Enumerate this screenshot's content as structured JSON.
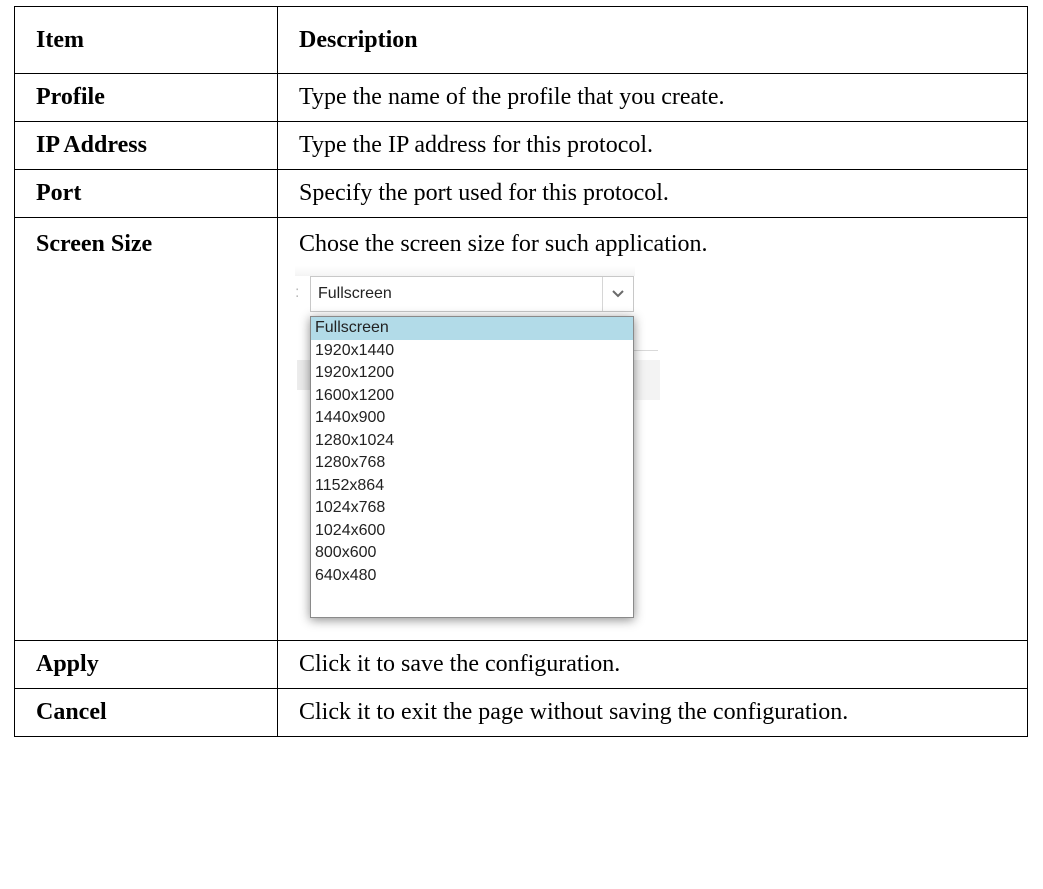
{
  "table": {
    "header": {
      "item": "Item",
      "description": "Description"
    },
    "rows": [
      {
        "item": "Profile",
        "description": "Type the name of the profile that you create."
      },
      {
        "item": "IP Address",
        "description": "Type the IP address for this protocol."
      },
      {
        "item": "Port",
        "description": "Specify the port used for this protocol."
      },
      {
        "item": "Screen Size",
        "description": "Chose the screen size for such application."
      },
      {
        "item": "Apply",
        "description": "Click it to save the configuration."
      },
      {
        "item": "Cancel",
        "description": "Click it to exit the page without saving the configuration."
      }
    ]
  },
  "screen_size_dropdown": {
    "label_punctuation": ":",
    "selected_value": "Fullscreen",
    "arrow_icon": "chevron-down-icon",
    "highlight_color": "#b2dbe8",
    "options": [
      "Fullscreen",
      "1920x1440",
      "1920x1200",
      "1600x1200",
      "1440x900",
      "1280x1024",
      "1280x768",
      "1152x864",
      "1024x768",
      "1024x600",
      "800x600",
      "640x480"
    ]
  }
}
